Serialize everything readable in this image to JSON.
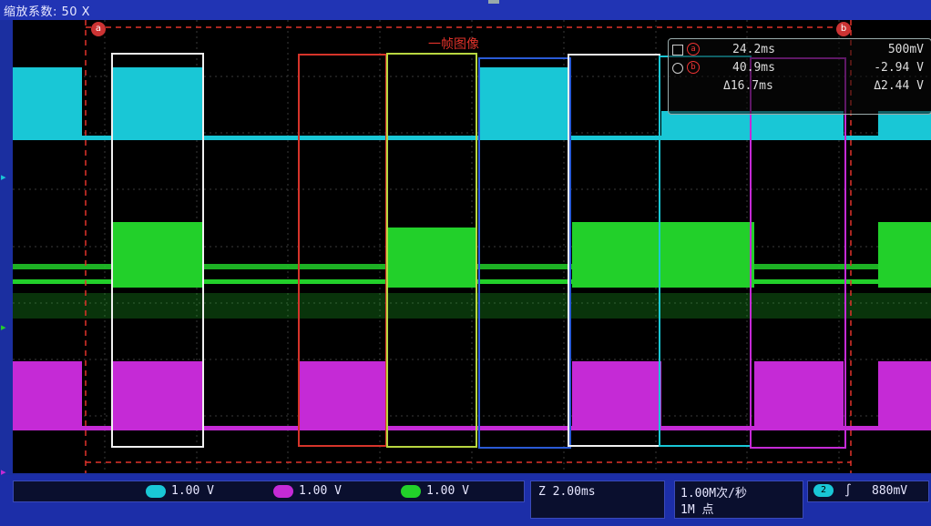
{
  "header": {
    "zoom_factor_label": "缩放系数: 50 X"
  },
  "waveform_area": {
    "title": "一帧图像"
  },
  "cursor_readout": {
    "a": {
      "marker": "a",
      "time": "24.2ms",
      "value": "500mV"
    },
    "b": {
      "marker": "b",
      "time": "40.9ms",
      "value": "-2.94 V"
    },
    "delta": {
      "time": "Δ16.7ms",
      "value": "Δ2.44 V"
    }
  },
  "cursor_tags": {
    "a": "a",
    "b": "b"
  },
  "channels": [
    {
      "id": "1",
      "scale": "1.00 V",
      "color": "#19c7d6"
    },
    {
      "id": "2",
      "scale": "1.00 V",
      "color": "#c52ad6"
    },
    {
      "id": "3",
      "scale": "1.00 V",
      "color": "#22d02a"
    }
  ],
  "timebase": {
    "label": "Z 2.00ms"
  },
  "acquisition": {
    "rate": "1.00M次/秒",
    "record": "1M 点"
  },
  "trigger": {
    "channel": "2",
    "slope": "∫",
    "level": "880mV"
  },
  "colors": {
    "ch1": "#19c7d6",
    "ch2": "#22d02a",
    "ch3": "#c52ad6",
    "cursor_a": "#e2322a",
    "background": "#000000",
    "frame": "#1b2fa0"
  }
}
